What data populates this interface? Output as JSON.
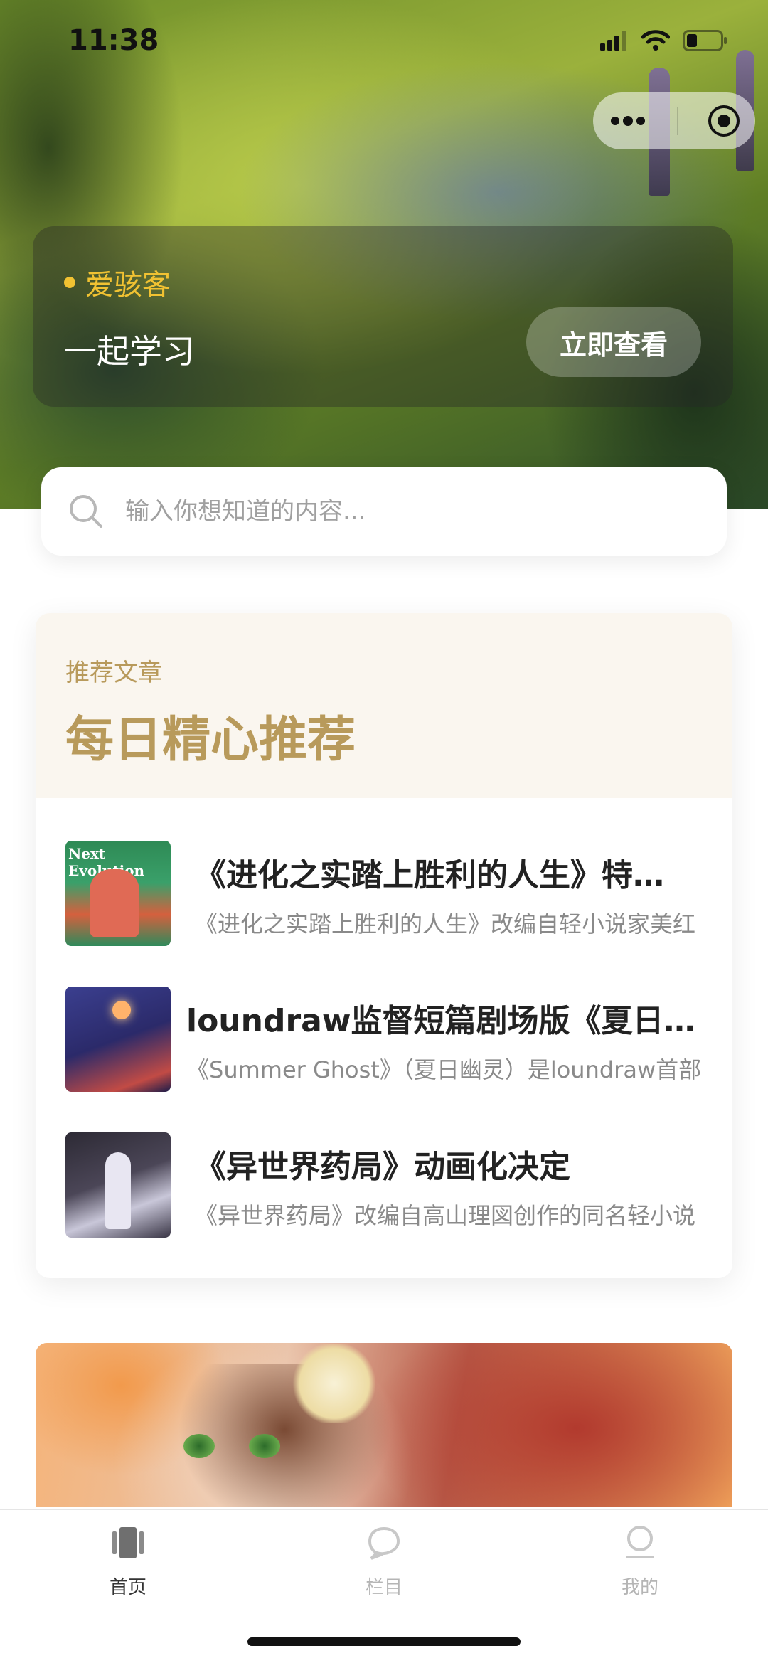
{
  "status_bar": {
    "time": "11:38"
  },
  "promo": {
    "brand": "爱骇客",
    "slogan": "一起学习",
    "cta": "立即查看"
  },
  "search": {
    "placeholder": "输入你想知道的内容..."
  },
  "recommend": {
    "subtitle": "推荐文章",
    "title": "每日精心推荐",
    "items": [
      {
        "title": "《进化之实踏上胜利的人生》特…",
        "desc": "《进化之实踏上胜利的人生》改编自轻小说家美红",
        "thumb_text": "Next Evolution"
      },
      {
        "title": "loundraw监督短篇剧场版《夏日…",
        "desc": "《Summer Ghost》（夏日幽灵）是loundraw首部"
      },
      {
        "title": "《异世界药局》动画化决定",
        "desc": "《异世界药局》改编自高山理図创作的同名轻小说"
      }
    ]
  },
  "tabbar": {
    "tabs": [
      {
        "label": "首页",
        "icon": "home-icon",
        "active": true
      },
      {
        "label": "栏目",
        "icon": "category-icon",
        "active": false
      },
      {
        "label": "我的",
        "icon": "profile-icon",
        "active": false
      }
    ],
    "active_color": "#333333",
    "inactive_color": "#b5b5b5"
  },
  "colors": {
    "accent_gold": "#b89a5b",
    "brand_yellow": "#f1c232"
  }
}
